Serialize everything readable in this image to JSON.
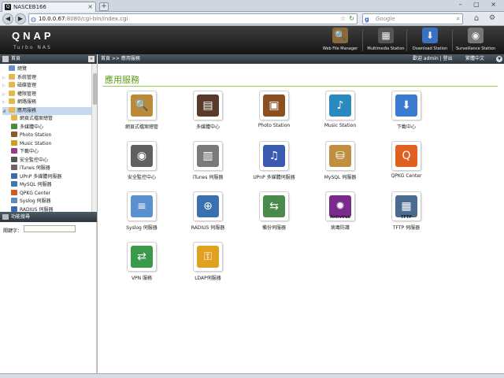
{
  "browser": {
    "tab_title": "NASCEB166",
    "tab_favicon": "Q",
    "tab_close": "×",
    "new_tab": "+",
    "window_controls": "– ▢ ×",
    "back": "◀",
    "forward": "▶",
    "url_host": "10.0.0.67",
    "url_rest": ":8080/cgi-bin/index.cgi",
    "search_placeholder": "Google",
    "search_engine_glyph": "g",
    "home_glyph": "⌂",
    "tools_glyph": "⚙"
  },
  "header": {
    "logo": "QNAP",
    "subtitle": "Turbo NAS",
    "shortcuts": [
      {
        "label": "Web File Manager",
        "icon": "folder-magnifier-icon",
        "glyph": "🔍",
        "color": "#8a6a3a"
      },
      {
        "label": "Multimedia Station",
        "icon": "multimedia-icon",
        "glyph": "▦",
        "color": "#555555"
      },
      {
        "label": "Download Station",
        "icon": "download-globe-icon",
        "glyph": "⬇",
        "color": "#3a70c0"
      },
      {
        "label": "Surveillance Station",
        "icon": "camera-dome-icon",
        "glyph": "◉",
        "color": "#777777"
      }
    ]
  },
  "left_panel": {
    "title": "首頁",
    "collapse_glyph": "«",
    "tree": [
      {
        "label": "總覽",
        "level": 0,
        "expand": "",
        "color": "#6b8fc0"
      },
      {
        "label": "系統管理",
        "level": 0,
        "expand": "▷",
        "color": "#e6b84a"
      },
      {
        "label": "磁碟管理",
        "level": 0,
        "expand": "▷",
        "color": "#e6b84a"
      },
      {
        "label": "權限管理",
        "level": 0,
        "expand": "▷",
        "color": "#e6b84a"
      },
      {
        "label": "網路服務",
        "level": 0,
        "expand": "▷",
        "color": "#e6b84a"
      },
      {
        "label": "應用服務",
        "level": 0,
        "expand": "◢",
        "color": "#e6b84a",
        "selected": true
      },
      {
        "label": "網頁式檔案總管",
        "level": 1,
        "expand": "",
        "color": "#e6b84a"
      },
      {
        "label": "多媒體中心",
        "level": 1,
        "expand": "",
        "color": "#4a8a3a"
      },
      {
        "label": "Photo Station",
        "level": 1,
        "expand": "",
        "color": "#8a5a2a"
      },
      {
        "label": "Music Station",
        "level": 1,
        "expand": "",
        "color": "#c9a020"
      },
      {
        "label": "下載中心",
        "level": 1,
        "expand": "",
        "color": "#9a3a8a"
      },
      {
        "label": "安全監控中心",
        "level": 1,
        "expand": "",
        "color": "#555555"
      },
      {
        "label": "iTunes 伺服器",
        "level": 1,
        "expand": "",
        "color": "#666666"
      },
      {
        "label": "UPnP 多媒體伺服器",
        "level": 1,
        "expand": "",
        "color": "#3a6ab0"
      },
      {
        "label": "MySQL 伺服器",
        "level": 1,
        "expand": "",
        "color": "#3a7ab0"
      },
      {
        "label": "QPKG Center",
        "level": 1,
        "expand": "",
        "color": "#d05a20"
      },
      {
        "label": "Syslog 伺服器",
        "level": 1,
        "expand": "",
        "color": "#5a8ac0"
      },
      {
        "label": "RADIUS 伺服器",
        "level": 1,
        "expand": "",
        "color": "#3a6ab0"
      }
    ],
    "function_search": {
      "title": "功能搜尋",
      "keyword_label": "關鍵字：",
      "keyword_value": ""
    }
  },
  "topbar": {
    "breadcrumb": "首頁 >> 應用服務",
    "welcome": "歡迎 admin | 登出",
    "language": "繁體中文",
    "lang_arrow": "▼"
  },
  "main": {
    "title": "應用服務",
    "apps": [
      {
        "label": "網頁式檔案總管",
        "icon": "web-file-manager-icon",
        "glyph": "🔍",
        "color": "#b88a3a"
      },
      {
        "label": "多媒體中心",
        "icon": "multimedia-station-icon",
        "glyph": "▤",
        "color": "#5a3a2a"
      },
      {
        "label": "Photo Station",
        "icon": "photo-station-icon",
        "glyph": "▣",
        "color": "#8a5020"
      },
      {
        "label": "Music Station",
        "icon": "music-station-icon",
        "glyph": "♪",
        "color": "#2a8ac0"
      },
      {
        "label": "下載中心",
        "icon": "download-station-icon",
        "glyph": "⬇",
        "color": "#3a7ad0"
      },
      {
        "label": "安全監控中心",
        "icon": "surveillance-camera-icon",
        "glyph": "◉",
        "color": "#606060"
      },
      {
        "label": "iTunes 伺服器",
        "icon": "itunes-server-icon",
        "glyph": "▥",
        "color": "#7a7a7a"
      },
      {
        "label": "UPnP 多媒體伺服器",
        "icon": "upnp-server-icon",
        "glyph": "♫",
        "color": "#3a5ab0"
      },
      {
        "label": "MySQL 伺服器",
        "icon": "mysql-server-icon",
        "glyph": "⛁",
        "color": "#c09040"
      },
      {
        "label": "QPKG Center",
        "icon": "qpkg-center-icon",
        "glyph": "Q",
        "color": "#e06020"
      },
      {
        "label": "Syslog 伺服器",
        "icon": "syslog-server-icon",
        "glyph": "≡",
        "color": "#5a90d0"
      },
      {
        "label": "RADIUS 伺服器",
        "icon": "radius-server-icon",
        "glyph": "⊕",
        "color": "#3a70b0"
      },
      {
        "label": "備份伺服器",
        "icon": "backup-server-icon",
        "glyph": "⇆",
        "color": "#4a8a4a"
      },
      {
        "label": "病毒防護",
        "icon": "antivirus-icon",
        "glyph": "✹",
        "color": "#7a2a8a",
        "caption": "Antivirus"
      },
      {
        "label": "TFTP 伺服器",
        "icon": "tftp-server-icon",
        "glyph": "▦",
        "color": "#4a6a90",
        "caption": "TFTP"
      },
      {
        "label": "VPN 服務",
        "icon": "vpn-service-icon",
        "glyph": "⇄",
        "color": "#3a9a4a"
      },
      {
        "label": "LDAP伺服器",
        "icon": "ldap-server-icon",
        "glyph": "⚿",
        "color": "#e0a020"
      }
    ]
  }
}
